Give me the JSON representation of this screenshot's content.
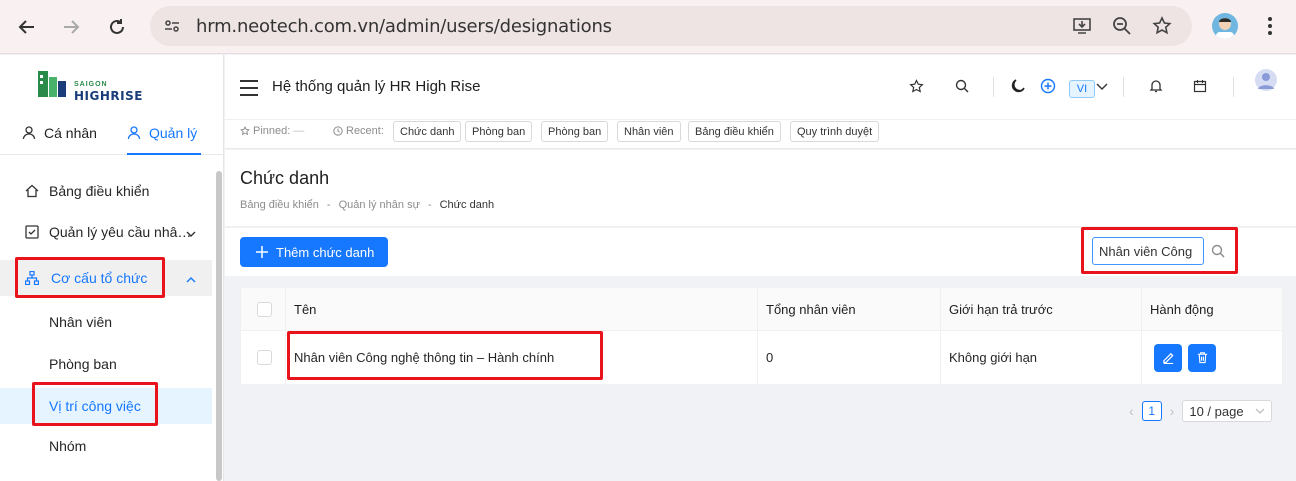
{
  "browser": {
    "url": "hrm.neotech.com.vn/admin/users/designations"
  },
  "brand": {
    "logo_top": "SAIGON",
    "logo_main": "HIGHRISE",
    "green": "#2a8a4a",
    "navy": "#1a3d7a"
  },
  "sidebar": {
    "tabs": [
      {
        "label": "Cá nhân"
      },
      {
        "label": "Quản lý"
      }
    ],
    "items": [
      {
        "label": "Bảng điều khiển",
        "icon": "home-icon"
      },
      {
        "label": "Quản lý yêu cầu nhâ…",
        "icon": "checkbox-icon"
      },
      {
        "label": "Cơ cấu tổ chức",
        "icon": "org-chart-icon"
      },
      {
        "label": "Nhân viên"
      },
      {
        "label": "Phòng ban"
      },
      {
        "label": "Vị trí công việc"
      },
      {
        "label": "Nhóm"
      }
    ]
  },
  "header": {
    "title": "Hệ thống quản lý HR High Rise",
    "lang": "VI"
  },
  "recent": {
    "pinned_label": "Pinned:",
    "pinned_value": "—",
    "recent_label": "Recent:",
    "chips": [
      "Chức danh",
      "Phòng ban",
      "Phòng ban",
      "Nhân viên",
      "Bảng điều khiển",
      "Quy trình duyệt"
    ]
  },
  "page": {
    "title": "Chức danh",
    "breadcrumb": [
      "Bảng điều khiển",
      "-",
      "Quản lý nhân sự",
      "-",
      "Chức danh"
    ]
  },
  "toolbar": {
    "add_label": "Thêm chức danh",
    "search_value": "Nhân viên Công"
  },
  "table": {
    "columns": [
      "Tên",
      "Tổng nhân viên",
      "Giới hạn trả trước",
      "Hành động"
    ],
    "rows": [
      {
        "name": "Nhân viên Công nghệ thông tin – Hành chính",
        "total": "0",
        "limit": "Không giới hạn"
      }
    ]
  },
  "pagination": {
    "current": "1",
    "page_size": "10 / page"
  },
  "colors": {
    "primary": "#1677ff",
    "highlight": "#e8131b"
  }
}
